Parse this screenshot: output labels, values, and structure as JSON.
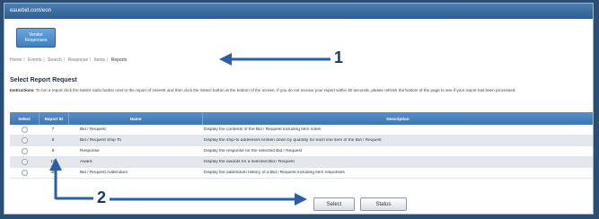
{
  "window": {
    "title": "eauebid.com/eon"
  },
  "tile": {
    "line1": "Vendor",
    "line2": "Responses"
  },
  "breadcrumb": {
    "items": [
      "Home",
      "Events",
      "Search",
      "Response",
      "Items"
    ],
    "current": "Reports"
  },
  "page": {
    "title": "Select Report Request",
    "instructions_label": "Instructions",
    "instructions_text": "To run a report click the Select radio button next to the report of interest and then click the Select button at the bottom of the screen. If you do not receive your report within 60 seconds, please refresh the bottom of the page to see if your report has been processed."
  },
  "table": {
    "headers": {
      "select": "Select",
      "report_id": "Report ID",
      "name": "Name",
      "description": "Description"
    },
    "rows": [
      {
        "id": "7",
        "name": "Bid / Request",
        "description": "Display the contents of the Bid / Request including item notes"
      },
      {
        "id": "8",
        "name": "Bid / Request Ship To",
        "description": "Display the ship-to addresses broken down by quantity for each line item of the Bid / Request"
      },
      {
        "id": "9",
        "name": "Response",
        "description": "Display the response for the selected Bid / Request"
      },
      {
        "id": "10",
        "name": "Award",
        "description": "Display the awards for a selected Bid / Request"
      },
      {
        "id": "38",
        "name": "Bid / Request Addendum",
        "description": "Display the addendum history of a Bid / Request including item responses"
      }
    ]
  },
  "buttons": {
    "select": "Select",
    "status": "Status"
  },
  "annotations": {
    "label1": "1",
    "label2": "2",
    "color": "#2a5fa8"
  }
}
